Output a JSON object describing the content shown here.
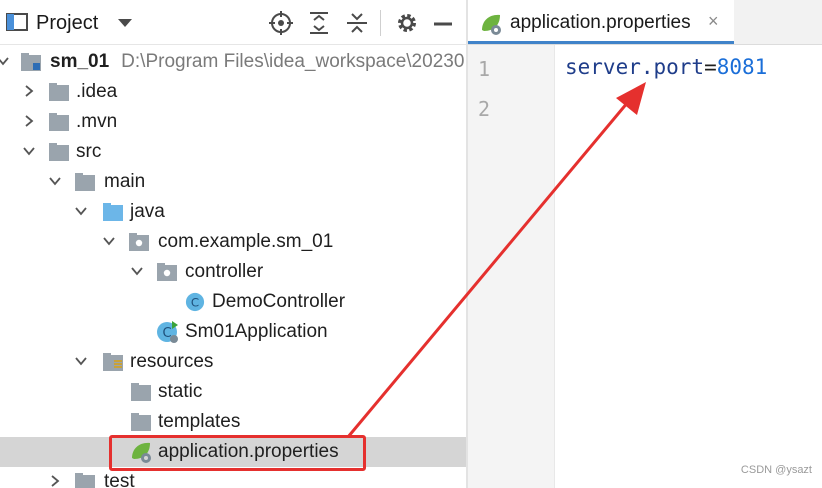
{
  "project_panel": {
    "title": "Project",
    "tree": [
      {
        "label": "sm_01",
        "path": "D:\\Program Files\\idea_workspace\\20230"
      },
      {
        "label": ".idea"
      },
      {
        "label": ".mvn"
      },
      {
        "label": "src"
      },
      {
        "label": "main"
      },
      {
        "label": "java"
      },
      {
        "label": "com.example.sm_01"
      },
      {
        "label": "controller"
      },
      {
        "label": "DemoController"
      },
      {
        "label": "Sm01Application"
      },
      {
        "label": "resources"
      },
      {
        "label": "static"
      },
      {
        "label": "templates"
      },
      {
        "label": "application.properties"
      },
      {
        "label": "test"
      }
    ]
  },
  "editor": {
    "tab_label": "application.properties",
    "tab_close": "×",
    "line_numbers": [
      "1",
      "2"
    ],
    "code": {
      "key": "server.port",
      "op": "=",
      "value": "8081"
    }
  },
  "watermark": "CSDN @ysazt",
  "colors": {
    "accent": "#4083c9",
    "annotation": "#e5302e",
    "selection": "#d5d5d5"
  }
}
